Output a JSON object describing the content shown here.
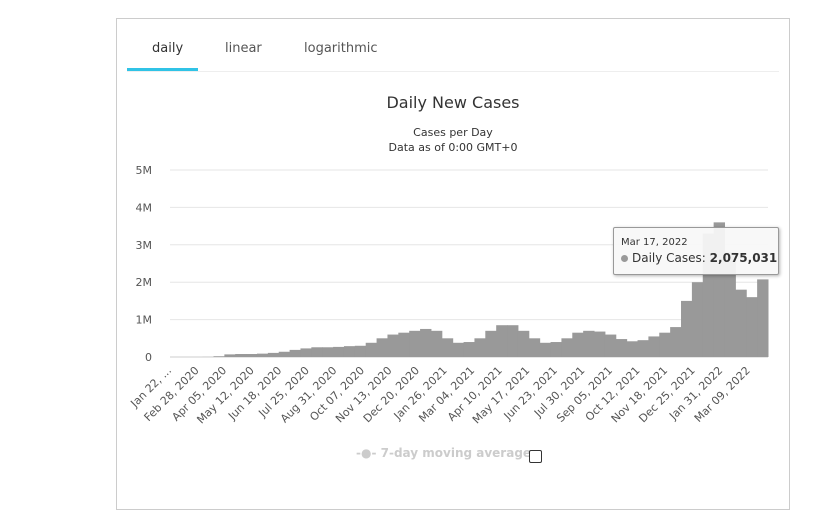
{
  "tabs": [
    "daily",
    "linear",
    "logarithmic"
  ],
  "active_tab": "daily",
  "chart_data": {
    "type": "bar",
    "title": "Daily New Cases",
    "subtitle": "Cases per Day",
    "subtitle2": "Data as of 0:00 GMT+0",
    "ylim": [
      0,
      5000000
    ],
    "yticks": [
      "0",
      "1M",
      "2M",
      "3M",
      "4M",
      "5M"
    ],
    "ytick_values": [
      0,
      1000000,
      2000000,
      3000000,
      4000000,
      5000000
    ],
    "grid": true,
    "color": "#999999",
    "xtick_labels": [
      "Jan 22, ...",
      "Feb 28, 2020",
      "Apr 05, 2020",
      "May 12, 2020",
      "Jun 18, 2020",
      "Jul 25, 2020",
      "Aug 31, 2020",
      "Oct 07, 2020",
      "Nov 13, 2020",
      "Dec 20, 2020",
      "Jan 26, 2021",
      "Mar 04, 2021",
      "Apr 10, 2021",
      "May 17, 2021",
      "Jun 23, 2021",
      "Jul 30, 2021",
      "Sep 05, 2021",
      "Oct 12, 2021",
      "Nov 18, 2021",
      "Dec 25, 2021",
      "Jan 31, 2022",
      "Mar 09, 2022"
    ],
    "series": [
      {
        "name": "Daily Cases",
        "values": [
          0,
          0,
          0,
          2000,
          20000,
          70000,
          80000,
          80000,
          90000,
          110000,
          140000,
          190000,
          230000,
          260000,
          260000,
          270000,
          290000,
          300000,
          380000,
          500000,
          600000,
          650000,
          700000,
          750000,
          700000,
          500000,
          380000,
          400000,
          500000,
          700000,
          850000,
          850000,
          700000,
          500000,
          380000,
          400000,
          500000,
          650000,
          700000,
          680000,
          600000,
          480000,
          420000,
          450000,
          550000,
          650000,
          800000,
          1500000,
          2000000,
          3300000,
          3600000,
          2800000,
          1800000,
          1600000,
          2075031
        ]
      }
    ],
    "legend": [
      {
        "label": "7-day moving average",
        "enabled": false
      }
    ],
    "tooltip": {
      "date": "Mar 17, 2022",
      "series": "Daily Cases:",
      "value": "2,075,031"
    }
  }
}
